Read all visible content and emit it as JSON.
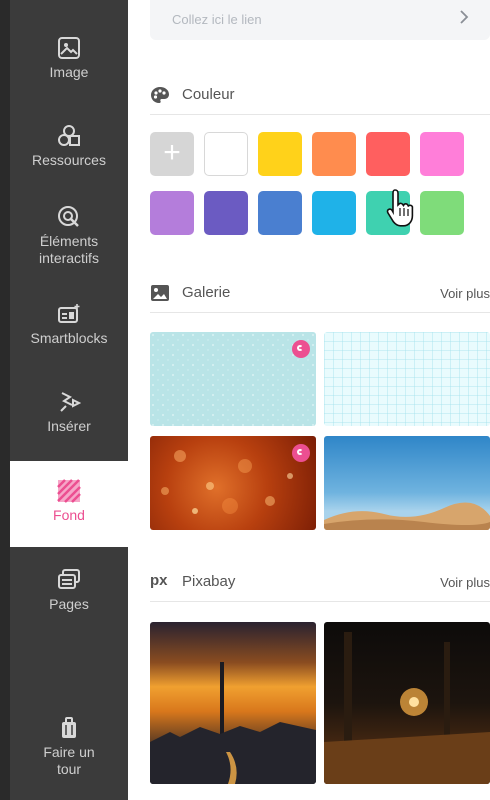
{
  "link_input": {
    "placeholder": "Collez ici le lien"
  },
  "sidebar": {
    "items": [
      {
        "label": "Image",
        "icon": "image-icon"
      },
      {
        "label": "Ressources",
        "icon": "shapes-icon"
      },
      {
        "label": "Éléments interactifs",
        "icon": "interactive-icon"
      },
      {
        "label": "Smartblocks",
        "icon": "smartblocks-icon"
      },
      {
        "label": "Insérer",
        "icon": "insert-icon"
      },
      {
        "label": "Fond",
        "icon": "background-icon",
        "active": true
      },
      {
        "label": "Pages",
        "icon": "pages-icon"
      },
      {
        "label": "Faire un tour",
        "icon": "tour-icon"
      }
    ]
  },
  "colors_section": {
    "title": "Couleur",
    "icon": "palette-icon",
    "add_label": "+",
    "swatches": [
      "#ffffff",
      "#ffd21a",
      "#ff8c4e",
      "#ff5f5f",
      "#ff7ed9",
      "#b47ddb",
      "#6b5bc2",
      "#4a7fd0",
      "#1fb2e8",
      "#3fd1b0",
      "#7fdc7a"
    ]
  },
  "gallery_section": {
    "title": "Galerie",
    "icon": "gallery-icon",
    "more": "Voir plus"
  },
  "pixabay_section": {
    "title": "Pixabay",
    "logo": "px",
    "more": "Voir plus"
  }
}
